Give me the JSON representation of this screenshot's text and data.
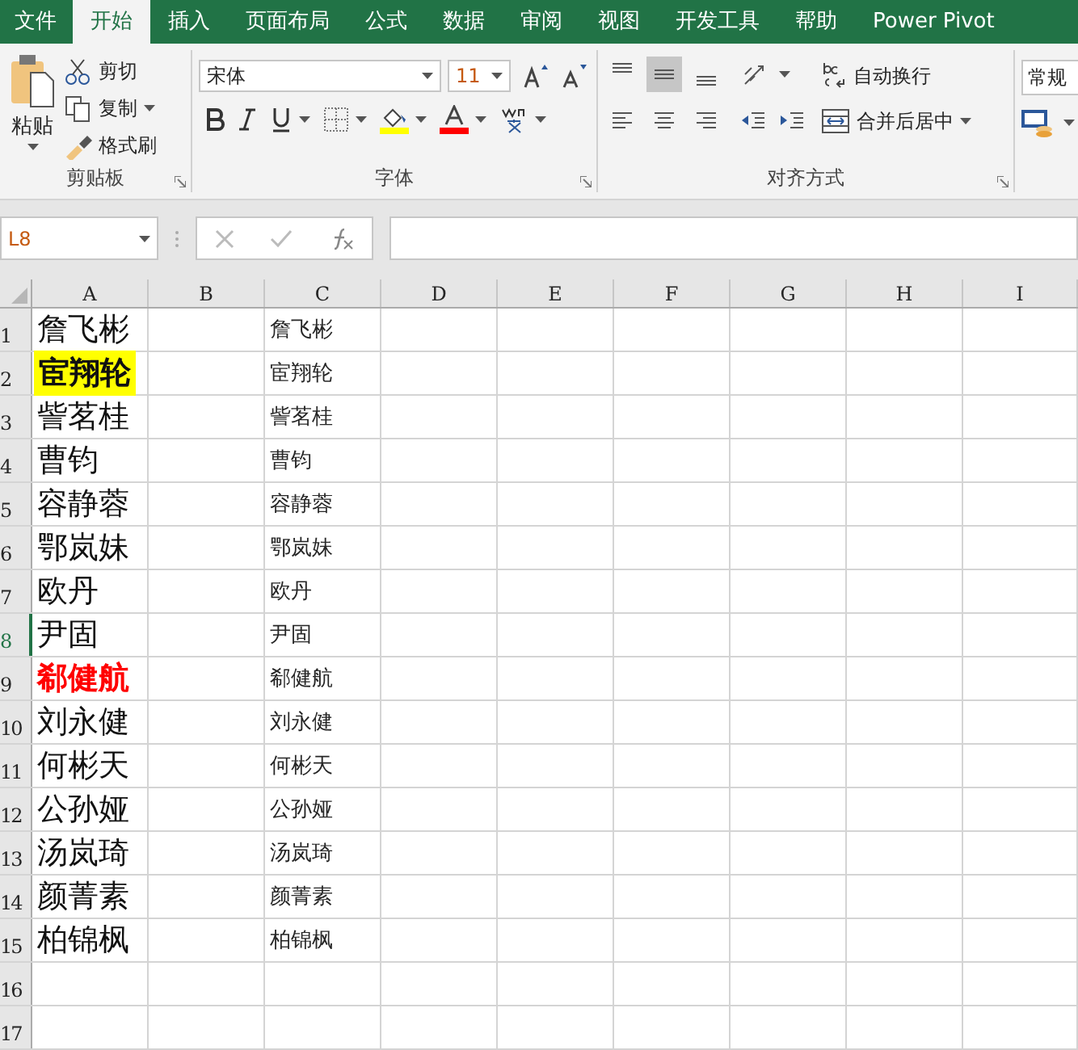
{
  "ribbon_tabs": [
    {
      "label": "文件",
      "selected": false
    },
    {
      "label": "开始",
      "selected": true
    },
    {
      "label": "插入",
      "selected": false
    },
    {
      "label": "页面布局",
      "selected": false
    },
    {
      "label": "公式",
      "selected": false
    },
    {
      "label": "数据",
      "selected": false
    },
    {
      "label": "审阅",
      "selected": false
    },
    {
      "label": "视图",
      "selected": false
    },
    {
      "label": "开发工具",
      "selected": false
    },
    {
      "label": "帮助",
      "selected": false
    },
    {
      "label": "Power Pivot",
      "selected": false
    }
  ],
  "clipboard": {
    "paste": "粘贴",
    "cut": "剪切",
    "copy": "复制",
    "format_painter": "格式刷",
    "label": "剪贴板"
  },
  "font": {
    "name": "宋体",
    "size": "11",
    "label": "字体"
  },
  "alignment": {
    "vertical": [
      {
        "selected": false
      },
      {
        "selected": true
      },
      {
        "selected": false
      }
    ],
    "wrap_text": "自动换行",
    "merge_center": "合并后居中",
    "label": "对齐方式"
  },
  "number": {
    "format": "常规"
  },
  "formula_bar": {
    "name_box": "L8"
  },
  "columns": [
    {
      "label": "A"
    },
    {
      "label": "B"
    },
    {
      "label": "C"
    },
    {
      "label": "D"
    },
    {
      "label": "E"
    },
    {
      "label": "F"
    },
    {
      "label": "G"
    },
    {
      "label": "H"
    },
    {
      "label": "I"
    }
  ],
  "rows": [
    {
      "number": "1",
      "selected": false,
      "a": {
        "text": "詹飞彬",
        "kind": "plain"
      },
      "c": "詹飞彬"
    },
    {
      "number": "2",
      "selected": false,
      "a": {
        "text": "宦翔轮",
        "kind": "highlighted"
      },
      "c": "宦翔轮"
    },
    {
      "number": "3",
      "selected": false,
      "a": {
        "text": "訾茗桂",
        "kind": "plain"
      },
      "c": "訾茗桂"
    },
    {
      "number": "4",
      "selected": false,
      "a": {
        "text": "曹钧",
        "kind": "plain"
      },
      "c": "曹钧"
    },
    {
      "number": "5",
      "selected": false,
      "a": {
        "text": "容静蓉",
        "kind": "plain"
      },
      "c": "容静蓉"
    },
    {
      "number": "6",
      "selected": false,
      "a": {
        "text": "鄂岚妹",
        "kind": "plain"
      },
      "c": "鄂岚妹"
    },
    {
      "number": "7",
      "selected": false,
      "a": {
        "text": "欧丹",
        "kind": "plain"
      },
      "c": "欧丹"
    },
    {
      "number": "8",
      "selected": true,
      "a": {
        "text": "尹固",
        "kind": "plain"
      },
      "c": "尹固"
    },
    {
      "number": "9",
      "selected": false,
      "a": {
        "text": "郗健航",
        "kind": "red-bold"
      },
      "c": "郗健航"
    },
    {
      "number": "10",
      "selected": false,
      "a": {
        "text": "刘永健",
        "kind": "plain"
      },
      "c": "刘永健"
    },
    {
      "number": "11",
      "selected": false,
      "a": {
        "text": "何彬天",
        "kind": "plain"
      },
      "c": "何彬天"
    },
    {
      "number": "12",
      "selected": false,
      "a": {
        "text": "公孙娅",
        "kind": "plain"
      },
      "c": "公孙娅"
    },
    {
      "number": "13",
      "selected": false,
      "a": {
        "text": "汤岚琦",
        "kind": "plain"
      },
      "c": "汤岚琦"
    },
    {
      "number": "14",
      "selected": false,
      "a": {
        "text": "颜菁素",
        "kind": "plain"
      },
      "c": "颜菁素"
    },
    {
      "number": "15",
      "selected": false,
      "a": {
        "text": "柏锦枫",
        "kind": "plain"
      },
      "c": "柏锦枫"
    },
    {
      "number": "16",
      "selected": false
    },
    {
      "number": "17",
      "selected": false
    }
  ]
}
